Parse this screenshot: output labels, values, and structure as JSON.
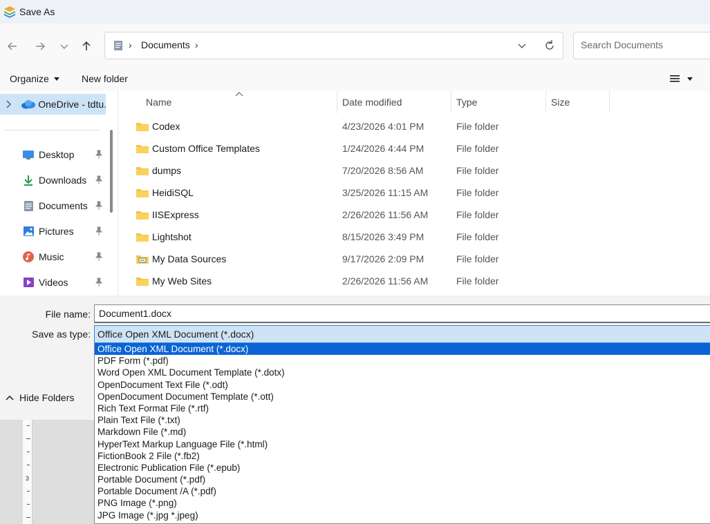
{
  "window": {
    "title": "Save As"
  },
  "address": {
    "crumb": "Documents"
  },
  "search": {
    "placeholder": "Search Documents"
  },
  "commands": {
    "organize": "Organize",
    "new_folder": "New folder"
  },
  "nav": {
    "onedrive": "OneDrive - tdtu.",
    "items": [
      {
        "label": "Desktop",
        "icon": "desktop-icon",
        "color": "#3b8ee8"
      },
      {
        "label": "Downloads",
        "icon": "download-icon",
        "color": "#2a9a52"
      },
      {
        "label": "Documents",
        "icon": "documents-icon",
        "color": "#6b7c93"
      },
      {
        "label": "Pictures",
        "icon": "pictures-icon",
        "color": "#2d7de0"
      },
      {
        "label": "Music",
        "icon": "music-icon",
        "color": "#e0614b"
      },
      {
        "label": "Videos",
        "icon": "videos-icon",
        "color": "#8a3fc9"
      }
    ]
  },
  "columns": {
    "name": "Name",
    "date": "Date modified",
    "type": "Type",
    "size": "Size"
  },
  "files": [
    {
      "name": "Codex",
      "date": "4/23/2026 4:01 PM",
      "type": "File folder",
      "icon": "folder-icon"
    },
    {
      "name": "Custom Office Templates",
      "date": "1/24/2026 4:44 PM",
      "type": "File folder",
      "icon": "folder-icon"
    },
    {
      "name": "dumps",
      "date": "7/20/2026 8:56 AM",
      "type": "File folder",
      "icon": "folder-icon"
    },
    {
      "name": "HeidiSQL",
      "date": "3/25/2026 11:15 AM",
      "type": "File folder",
      "icon": "folder-icon"
    },
    {
      "name": "IISExpress",
      "date": "2/26/2026 11:56 AM",
      "type": "File folder",
      "icon": "folder-icon"
    },
    {
      "name": "Lightshot",
      "date": "8/15/2026 3:49 PM",
      "type": "File folder",
      "icon": "folder-icon"
    },
    {
      "name": "My Data Sources",
      "date": "9/17/2026 2:09 PM",
      "type": "File folder",
      "icon": "data-sources-folder-icon"
    },
    {
      "name": "My Web Sites",
      "date": "2/26/2026 11:56 AM",
      "type": "File folder",
      "icon": "folder-icon"
    }
  ],
  "form": {
    "file_name_label": "File name:",
    "file_name_value": "Document1.docx",
    "save_type_label": "Save as type:",
    "save_type_value": "Office Open XML Document (*.docx)"
  },
  "save_type_options": [
    "Office Open XML Document (*.docx)",
    "PDF Form (*.pdf)",
    "Word Open XML Document Template (*.dotx)",
    "OpenDocument Text File (*.odt)",
    "OpenDocument Document Template (*.ott)",
    "Rich Text Format File (*.rtf)",
    "Plain Text File (*.txt)",
    "Markdown File (*.md)",
    "HyperText Markup Language File (*.html)",
    "FictionBook 2 File (*.fb2)",
    "Electronic Publication File (*.epub)",
    "Portable Document (*.pdf)",
    "Portable Document /A (*.pdf)",
    "PNG Image (*.png)",
    "JPG Image (*.jpg *.jpeg)"
  ],
  "selected_option_index": 0,
  "hide_folders": "Hide Folders",
  "ruler_numbers": [
    "3"
  ],
  "colors": {
    "accent": "#0a64d6",
    "folder": "#f4c342",
    "selection": "#cde3f7"
  }
}
